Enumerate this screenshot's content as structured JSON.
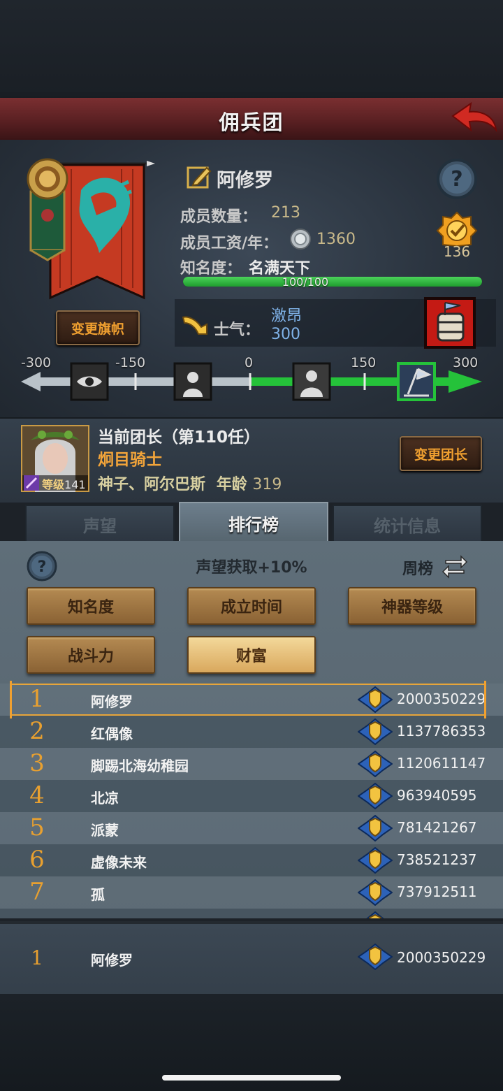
{
  "header": {
    "title": "佣兵团"
  },
  "guild": {
    "name": "阿修罗",
    "change_banner_label": "变更旗帜",
    "member_count_label": "成员数量：",
    "member_count": "213",
    "salary_label": "成员工资/年：",
    "salary": "1360",
    "fame_label": "知名度：",
    "fame_value": "名满天下",
    "fame_progress_text": "100/100",
    "fame_progress": 1.0,
    "rank_badge_value": "136",
    "morale_label": "士气：",
    "morale_status": "激昂",
    "morale_value": "300"
  },
  "morale_scale": {
    "ticks": [
      "-300",
      "-150",
      "0",
      "150",
      "300"
    ],
    "current": 300
  },
  "leader": {
    "title": "当前团长（第110任）",
    "class": "炯目骑士",
    "name": "神子、阿尔巴斯",
    "age_label": "年龄",
    "age": "319",
    "level_label": "等级",
    "level": "141",
    "change_leader_label": "变更团长"
  },
  "tabs": [
    {
      "label": "声望",
      "active": false
    },
    {
      "label": "排行榜",
      "active": true
    },
    {
      "label": "统计信息",
      "active": false
    }
  ],
  "ranking": {
    "bonus_text": "声望获取+10%",
    "period_label": "周榜",
    "categories": [
      {
        "label": "知名度",
        "selected": false
      },
      {
        "label": "成立时间",
        "selected": false
      },
      {
        "label": "神器等级",
        "selected": false
      },
      {
        "label": "战斗力",
        "selected": false
      },
      {
        "label": "财富",
        "selected": true
      }
    ],
    "rows": [
      {
        "rank": "1",
        "name": "阿修罗",
        "value": "2000350229"
      },
      {
        "rank": "2",
        "name": "红偶像",
        "value": "1137786353"
      },
      {
        "rank": "3",
        "name": "脚踢北海幼稚园",
        "value": "1120611147"
      },
      {
        "rank": "4",
        "name": "北凉",
        "value": "963940595"
      },
      {
        "rank": "5",
        "name": "派蒙",
        "value": "781421267"
      },
      {
        "rank": "6",
        "name": "虚像未来",
        "value": "738521237"
      },
      {
        "rank": "7",
        "name": "孤",
        "value": "737912511"
      }
    ],
    "my_rank": {
      "rank": "1",
      "name": "阿修罗",
      "value": "2000350229"
    }
  },
  "colors": {
    "header_red": "#5a2022",
    "accent_orange": "#f0a030",
    "fame_green": "#2fb83e",
    "morale_blue": "#7fb2e8",
    "button_gold": "#d9a85d"
  }
}
